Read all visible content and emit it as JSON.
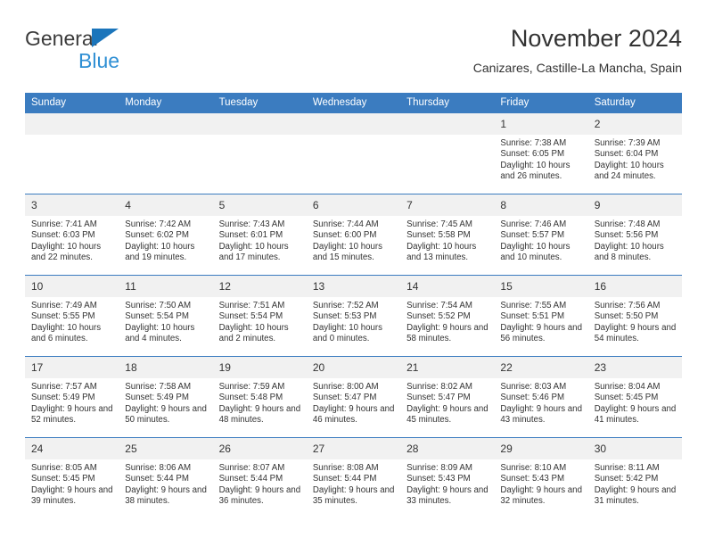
{
  "logo": {
    "word_one": "General",
    "word_two": "Blue",
    "triangle_icon": "triangle-icon",
    "accent_color": "#1b75bb",
    "blue_text_color": "#2f8fd4"
  },
  "header": {
    "title": "November 2024",
    "subtitle": "Canizares, Castille-La Mancha, Spain"
  },
  "theme": {
    "header_blue": "#3b7cc0",
    "daynum_band": "#f1f1f1",
    "text": "#333333"
  },
  "calendar": {
    "weekdays": [
      "Sunday",
      "Monday",
      "Tuesday",
      "Wednesday",
      "Thursday",
      "Friday",
      "Saturday"
    ],
    "weeks": [
      [
        {
          "day": "",
          "sunrise": "",
          "sunset": "",
          "daylight": ""
        },
        {
          "day": "",
          "sunrise": "",
          "sunset": "",
          "daylight": ""
        },
        {
          "day": "",
          "sunrise": "",
          "sunset": "",
          "daylight": ""
        },
        {
          "day": "",
          "sunrise": "",
          "sunset": "",
          "daylight": ""
        },
        {
          "day": "",
          "sunrise": "",
          "sunset": "",
          "daylight": ""
        },
        {
          "day": "1",
          "sunrise": "Sunrise: 7:38 AM",
          "sunset": "Sunset: 6:05 PM",
          "daylight": "Daylight: 10 hours and 26 minutes."
        },
        {
          "day": "2",
          "sunrise": "Sunrise: 7:39 AM",
          "sunset": "Sunset: 6:04 PM",
          "daylight": "Daylight: 10 hours and 24 minutes."
        }
      ],
      [
        {
          "day": "3",
          "sunrise": "Sunrise: 7:41 AM",
          "sunset": "Sunset: 6:03 PM",
          "daylight": "Daylight: 10 hours and 22 minutes."
        },
        {
          "day": "4",
          "sunrise": "Sunrise: 7:42 AM",
          "sunset": "Sunset: 6:02 PM",
          "daylight": "Daylight: 10 hours and 19 minutes."
        },
        {
          "day": "5",
          "sunrise": "Sunrise: 7:43 AM",
          "sunset": "Sunset: 6:01 PM",
          "daylight": "Daylight: 10 hours and 17 minutes."
        },
        {
          "day": "6",
          "sunrise": "Sunrise: 7:44 AM",
          "sunset": "Sunset: 6:00 PM",
          "daylight": "Daylight: 10 hours and 15 minutes."
        },
        {
          "day": "7",
          "sunrise": "Sunrise: 7:45 AM",
          "sunset": "Sunset: 5:58 PM",
          "daylight": "Daylight: 10 hours and 13 minutes."
        },
        {
          "day": "8",
          "sunrise": "Sunrise: 7:46 AM",
          "sunset": "Sunset: 5:57 PM",
          "daylight": "Daylight: 10 hours and 10 minutes."
        },
        {
          "day": "9",
          "sunrise": "Sunrise: 7:48 AM",
          "sunset": "Sunset: 5:56 PM",
          "daylight": "Daylight: 10 hours and 8 minutes."
        }
      ],
      [
        {
          "day": "10",
          "sunrise": "Sunrise: 7:49 AM",
          "sunset": "Sunset: 5:55 PM",
          "daylight": "Daylight: 10 hours and 6 minutes."
        },
        {
          "day": "11",
          "sunrise": "Sunrise: 7:50 AM",
          "sunset": "Sunset: 5:54 PM",
          "daylight": "Daylight: 10 hours and 4 minutes."
        },
        {
          "day": "12",
          "sunrise": "Sunrise: 7:51 AM",
          "sunset": "Sunset: 5:54 PM",
          "daylight": "Daylight: 10 hours and 2 minutes."
        },
        {
          "day": "13",
          "sunrise": "Sunrise: 7:52 AM",
          "sunset": "Sunset: 5:53 PM",
          "daylight": "Daylight: 10 hours and 0 minutes."
        },
        {
          "day": "14",
          "sunrise": "Sunrise: 7:54 AM",
          "sunset": "Sunset: 5:52 PM",
          "daylight": "Daylight: 9 hours and 58 minutes."
        },
        {
          "day": "15",
          "sunrise": "Sunrise: 7:55 AM",
          "sunset": "Sunset: 5:51 PM",
          "daylight": "Daylight: 9 hours and 56 minutes."
        },
        {
          "day": "16",
          "sunrise": "Sunrise: 7:56 AM",
          "sunset": "Sunset: 5:50 PM",
          "daylight": "Daylight: 9 hours and 54 minutes."
        }
      ],
      [
        {
          "day": "17",
          "sunrise": "Sunrise: 7:57 AM",
          "sunset": "Sunset: 5:49 PM",
          "daylight": "Daylight: 9 hours and 52 minutes."
        },
        {
          "day": "18",
          "sunrise": "Sunrise: 7:58 AM",
          "sunset": "Sunset: 5:49 PM",
          "daylight": "Daylight: 9 hours and 50 minutes."
        },
        {
          "day": "19",
          "sunrise": "Sunrise: 7:59 AM",
          "sunset": "Sunset: 5:48 PM",
          "daylight": "Daylight: 9 hours and 48 minutes."
        },
        {
          "day": "20",
          "sunrise": "Sunrise: 8:00 AM",
          "sunset": "Sunset: 5:47 PM",
          "daylight": "Daylight: 9 hours and 46 minutes."
        },
        {
          "day": "21",
          "sunrise": "Sunrise: 8:02 AM",
          "sunset": "Sunset: 5:47 PM",
          "daylight": "Daylight: 9 hours and 45 minutes."
        },
        {
          "day": "22",
          "sunrise": "Sunrise: 8:03 AM",
          "sunset": "Sunset: 5:46 PM",
          "daylight": "Daylight: 9 hours and 43 minutes."
        },
        {
          "day": "23",
          "sunrise": "Sunrise: 8:04 AM",
          "sunset": "Sunset: 5:45 PM",
          "daylight": "Daylight: 9 hours and 41 minutes."
        }
      ],
      [
        {
          "day": "24",
          "sunrise": "Sunrise: 8:05 AM",
          "sunset": "Sunset: 5:45 PM",
          "daylight": "Daylight: 9 hours and 39 minutes."
        },
        {
          "day": "25",
          "sunrise": "Sunrise: 8:06 AM",
          "sunset": "Sunset: 5:44 PM",
          "daylight": "Daylight: 9 hours and 38 minutes."
        },
        {
          "day": "26",
          "sunrise": "Sunrise: 8:07 AM",
          "sunset": "Sunset: 5:44 PM",
          "daylight": "Daylight: 9 hours and 36 minutes."
        },
        {
          "day": "27",
          "sunrise": "Sunrise: 8:08 AM",
          "sunset": "Sunset: 5:44 PM",
          "daylight": "Daylight: 9 hours and 35 minutes."
        },
        {
          "day": "28",
          "sunrise": "Sunrise: 8:09 AM",
          "sunset": "Sunset: 5:43 PM",
          "daylight": "Daylight: 9 hours and 33 minutes."
        },
        {
          "day": "29",
          "sunrise": "Sunrise: 8:10 AM",
          "sunset": "Sunset: 5:43 PM",
          "daylight": "Daylight: 9 hours and 32 minutes."
        },
        {
          "day": "30",
          "sunrise": "Sunrise: 8:11 AM",
          "sunset": "Sunset: 5:42 PM",
          "daylight": "Daylight: 9 hours and 31 minutes."
        }
      ]
    ]
  }
}
